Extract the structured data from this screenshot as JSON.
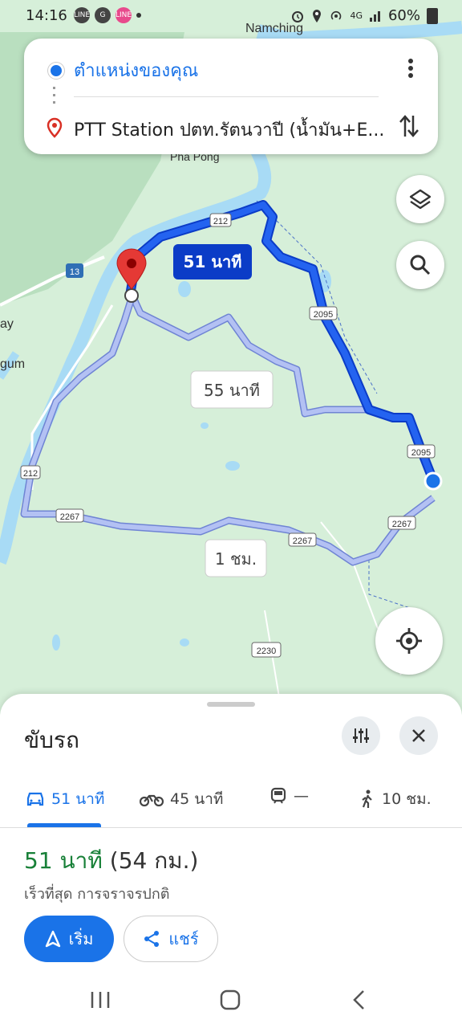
{
  "status_bar": {
    "time": "14:16",
    "app_icons": [
      "LINE",
      "G",
      "LINE"
    ],
    "battery": "60%",
    "network": "4G"
  },
  "directions": {
    "origin": "ตำแหน่งของคุณ",
    "destination": "PTT Station ปตท.รัตนวาปี (น้ำมัน+E..."
  },
  "map": {
    "place_labels": [
      "Namching",
      "Pha Pong",
      "ay",
      "gum"
    ],
    "road_shields": [
      "212",
      "2095",
      "2095",
      "212",
      "2267",
      "2267",
      "2267",
      "2230",
      "13"
    ],
    "route_labels": {
      "primary": "51 นาที",
      "alt1": "55 นาที",
      "alt2": "1 ชม."
    },
    "colors": {
      "route_primary": "#1a5ff0",
      "route_alt": "#a9b8f0",
      "water": "#a8dbf5",
      "land": "#d6efd9",
      "accent": "#1a73e8"
    }
  },
  "sheet": {
    "title": "ขับรถ",
    "modes": [
      {
        "icon": "car-icon",
        "label": "51 นาที",
        "active": true
      },
      {
        "icon": "motorcycle-icon",
        "label": "45 นาที",
        "active": false
      },
      {
        "icon": "transit-icon",
        "label": "—",
        "active": false
      },
      {
        "icon": "walk-icon",
        "label": "10 ชม.",
        "active": false
      }
    ],
    "route_time": "51 นาที",
    "route_distance": "(54 กม.)",
    "route_desc": "เร็วที่สุด การจราจรปกติ",
    "start_label": "เริ่ม",
    "share_label": "แชร์"
  }
}
